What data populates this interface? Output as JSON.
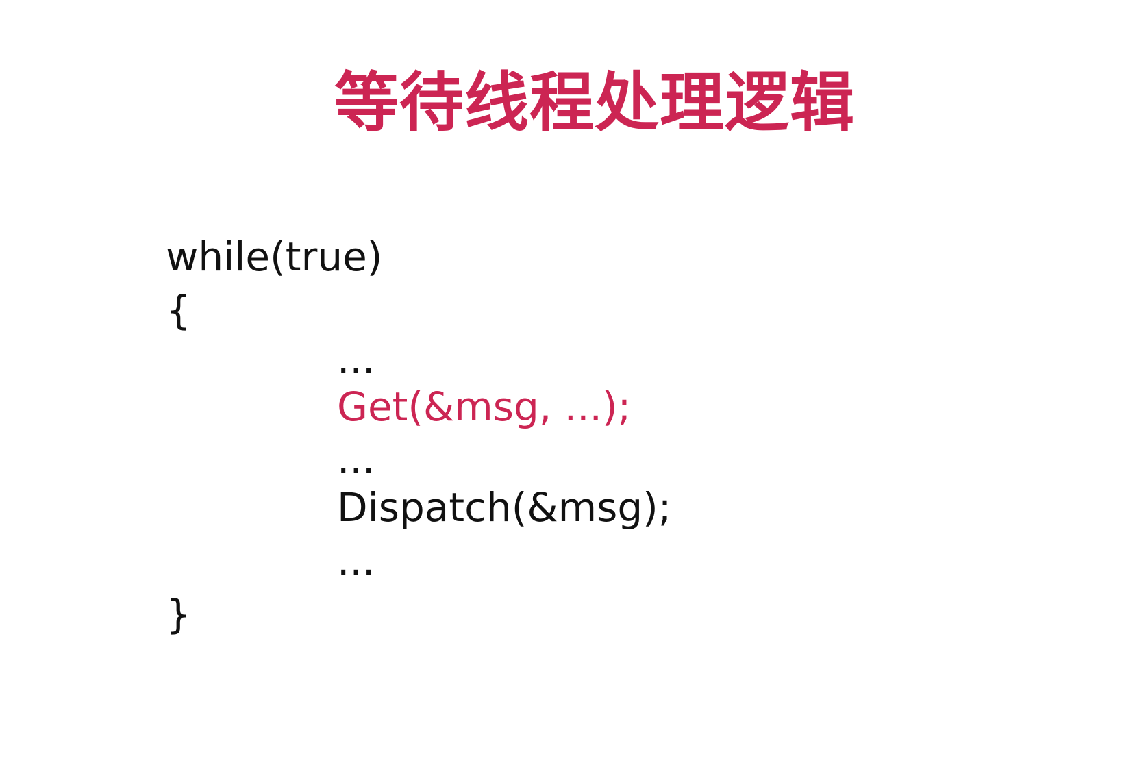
{
  "slide": {
    "title": "等待线程处理逻辑",
    "colors": {
      "accent": "#cc2553",
      "text": "#111111",
      "background": "#ffffff"
    },
    "code": {
      "lines": [
        {
          "text": "while(true)",
          "indent": 0,
          "highlight": false
        },
        {
          "text": "{",
          "indent": 0,
          "highlight": false
        },
        {
          "text": "...",
          "indent": 1,
          "highlight": false
        },
        {
          "text": "Get(&msg, ...);",
          "indent": 1,
          "highlight": true
        },
        {
          "text": "...",
          "indent": 1,
          "highlight": false
        },
        {
          "text": "Dispatch(&msg);",
          "indent": 1,
          "highlight": false
        },
        {
          "text": "...",
          "indent": 1,
          "highlight": false
        },
        {
          "text": "}",
          "indent": 0,
          "highlight": false
        }
      ]
    }
  }
}
